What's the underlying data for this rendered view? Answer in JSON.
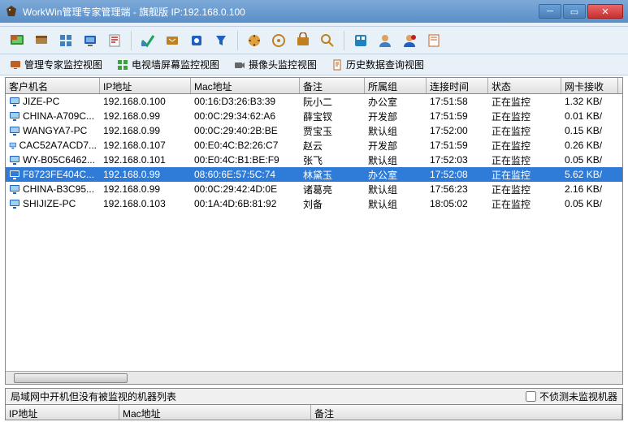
{
  "window": {
    "title": "WorkWin管理专家管理端 - 旗舰版 IP:192.168.0.100"
  },
  "tabs": [
    {
      "label": "管理专家监控视图"
    },
    {
      "label": "电视墙屏幕监控视图"
    },
    {
      "label": "摄像头监控视图"
    },
    {
      "label": "历史数据查询视图"
    }
  ],
  "columns": {
    "name": "客户机名",
    "ip": "IP地址",
    "mac": "Mac地址",
    "note": "备注",
    "group": "所属组",
    "time": "连接时间",
    "status": "状态",
    "net": "网卡接收"
  },
  "rows": [
    {
      "name": "JIZE-PC",
      "ip": "192.168.0.100",
      "mac": "00:16:D3:26:B3:39",
      "note": "阮小二",
      "group": "办公室",
      "time": "17:51:58",
      "status": "正在监控",
      "net": "1.32 KB/"
    },
    {
      "name": "CHINA-A709C...",
      "ip": "192.168.0.99",
      "mac": "00:0C:29:34:62:A6",
      "note": "薛宝钗",
      "group": "开发部",
      "time": "17:51:59",
      "status": "正在监控",
      "net": "0.01 KB/"
    },
    {
      "name": "WANGYA7-PC",
      "ip": "192.168.0.99",
      "mac": "00:0C:29:40:2B:BE",
      "note": "贾宝玉",
      "group": "默认组",
      "time": "17:52:00",
      "status": "正在监控",
      "net": "0.15 KB/"
    },
    {
      "name": "CAC52A7ACD7...",
      "ip": "192.168.0.107",
      "mac": "00:E0:4C:B2:26:C7",
      "note": "赵云",
      "group": "开发部",
      "time": "17:51:59",
      "status": "正在监控",
      "net": "0.26 KB/"
    },
    {
      "name": "WY-B05C6462...",
      "ip": "192.168.0.101",
      "mac": "00:E0:4C:B1:BE:F9",
      "note": "张飞",
      "group": "默认组",
      "time": "17:52:03",
      "status": "正在监控",
      "net": "0.05 KB/"
    },
    {
      "name": "F8723FE404C...",
      "ip": "192.168.0.99",
      "mac": "08:60:6E:57:5C:74",
      "note": "林黛玉",
      "group": "办公室",
      "time": "17:52:08",
      "status": "正在监控",
      "net": "5.62 KB/",
      "selected": true
    },
    {
      "name": "CHINA-B3C95...",
      "ip": "192.168.0.99",
      "mac": "00:0C:29:42:4D:0E",
      "note": "诸葛亮",
      "group": "默认组",
      "time": "17:56:23",
      "status": "正在监控",
      "net": "2.16 KB/"
    },
    {
      "name": "SHIJIZE-PC",
      "ip": "192.168.0.103",
      "mac": "00:1A:4D:6B:81:92",
      "note": "刘备",
      "group": "默认组",
      "time": "18:05:02",
      "status": "正在监控",
      "net": "0.05 KB/"
    }
  ],
  "bottom": {
    "label": "局域网中开机但没有被监视的机器列表",
    "checkbox": "不侦测未监视机器",
    "cols": {
      "ip": "IP地址",
      "mac": "Mac地址",
      "note": "备注"
    }
  },
  "iconColors": {
    "tb": [
      "#3a8a3a",
      "#c06020",
      "#2060c0",
      "#2060c0",
      "#c02020",
      "#20a060",
      "#c08020",
      "#2060c0",
      "#2060c0",
      "#c08020",
      "#c08020",
      "#c08020",
      "#c08020",
      "#2080c0",
      "#c06020",
      "#2060c0",
      "#c06020"
    ]
  }
}
